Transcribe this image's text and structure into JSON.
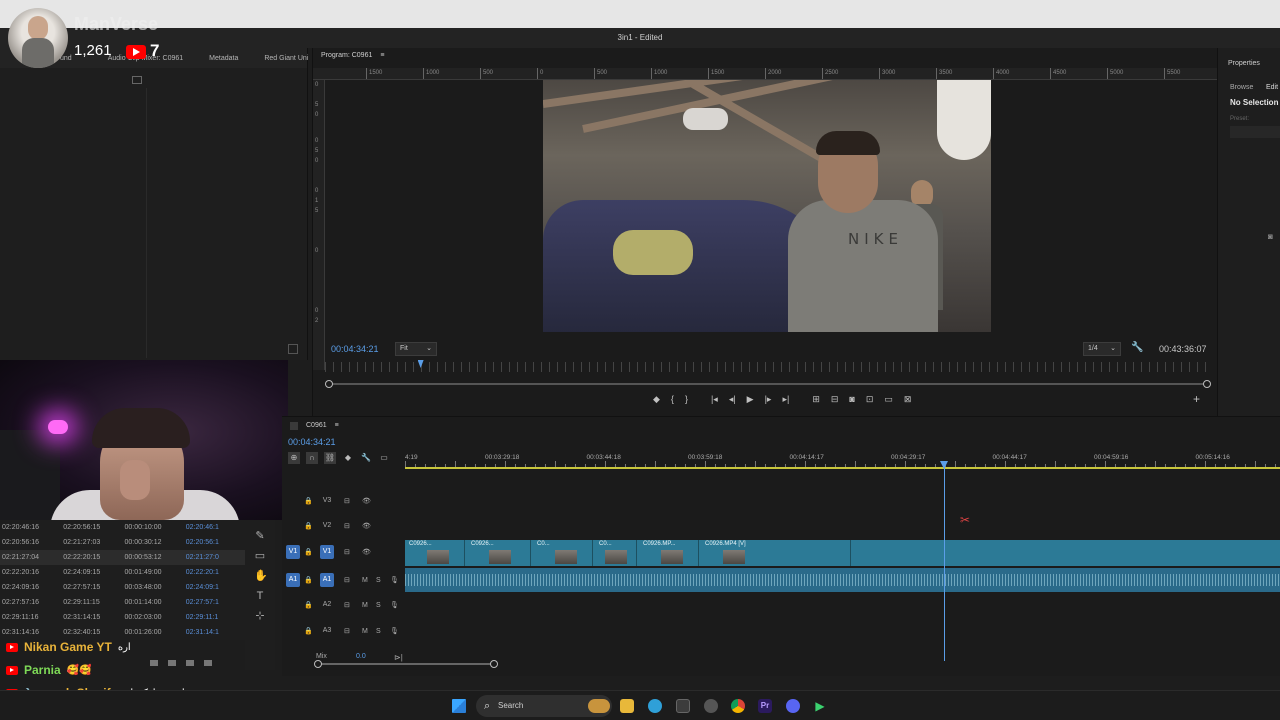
{
  "window": {
    "title": "3in1 - Edited"
  },
  "overlay": {
    "channel_name": "ManVerse",
    "subscriber_count": "1,261",
    "live_count": "7"
  },
  "left_panel": {
    "tabs": [
      "und",
      "Audio Clip Mixer: C0961",
      "Metadata",
      "Red Giant Uni"
    ],
    "more": "»"
  },
  "timestamps": {
    "rows": [
      [
        "02:20:46:16",
        "02:20:56:15",
        "00:00:10:00",
        "02:20:46:1"
      ],
      [
        "02:20:56:16",
        "02:21:27:03",
        "00:00:30:12",
        "02:20:56:1"
      ],
      [
        "02:21:27:04",
        "02:22:20:15",
        "00:00:53:12",
        "02:21:27:0"
      ],
      [
        "02:22:20:16",
        "02:24:09:15",
        "00:01:49:00",
        "02:22:20:1"
      ],
      [
        "02:24:09:16",
        "02:27:57:15",
        "00:03:48:00",
        "02:24:09:1"
      ],
      [
        "02:27:57:16",
        "02:29:11:15",
        "00:01:14:00",
        "02:27:57:1"
      ],
      [
        "02:29:11:16",
        "02:31:14:15",
        "00:02:03:00",
        "02:29:11:1"
      ],
      [
        "02:31:14:16",
        "02:32:40:15",
        "00:01:26:00",
        "02:31:14:1"
      ]
    ],
    "selected_row": 2
  },
  "program": {
    "tab": "Program: C0961",
    "ruler_ticks": [
      "1500",
      "1000",
      "500",
      "0",
      "500",
      "1000",
      "1500",
      "2000",
      "2500",
      "3000",
      "3500",
      "4000",
      "4500",
      "5000",
      "5500"
    ],
    "vertical_ticks": [
      "0",
      "5",
      "0",
      "0",
      "5",
      "0",
      "0",
      "1",
      "5",
      "0",
      "0",
      "2"
    ],
    "shirt_text": "NIKE",
    "timecode_left": "00:04:34:21",
    "fit": "Fit",
    "resolution": "1/4",
    "timecode_right": "00:43:36:07",
    "playhead_fraction": 0.105
  },
  "properties": {
    "title": "Properties",
    "tabs": [
      "Browse",
      "Edit"
    ],
    "no_selection": "No Selection",
    "preset_label": "Preset:"
  },
  "timeline": {
    "tab": "C0961",
    "timecode": "00:04:34:21",
    "ruler_ticks": [
      "4:19",
      "00:03:29:18",
      "00:03:44:18",
      "00:03:59:18",
      "00:04:14:17",
      "00:04:29:17",
      "00:04:44:17",
      "00:04:59:16",
      "00:05:14:16"
    ],
    "tracks": [
      {
        "name": "V3",
        "target": "",
        "type": "video"
      },
      {
        "name": "V2",
        "target": "",
        "type": "video"
      },
      {
        "name": "V1",
        "target": "V1",
        "type": "video"
      },
      {
        "name": "A1",
        "target": "A1",
        "type": "audio"
      },
      {
        "name": "A2",
        "target": "",
        "type": "audio"
      },
      {
        "name": "A3",
        "target": "",
        "type": "audio"
      }
    ],
    "clips": [
      "C0926...",
      "C0926...",
      "C0...",
      "C0...",
      "C0926.MP...",
      "C0926.MP4 [V]"
    ],
    "mix_label": "Mix",
    "mix_value": "0.0",
    "track_buttons": {
      "mute": "M",
      "solo": "S"
    }
  },
  "taskbar": {
    "search_placeholder": "Search"
  },
  "chat": [
    {
      "user": "Nikan Game YT",
      "message": "اره",
      "color": "#e8b33a"
    },
    {
      "user": "Parnia",
      "message": "🥰🥰",
      "color": "#7ed957"
    },
    {
      "user": "arash Sharif",
      "message": "تولدتم مبارک باشه",
      "color": "#e8b33a"
    }
  ]
}
